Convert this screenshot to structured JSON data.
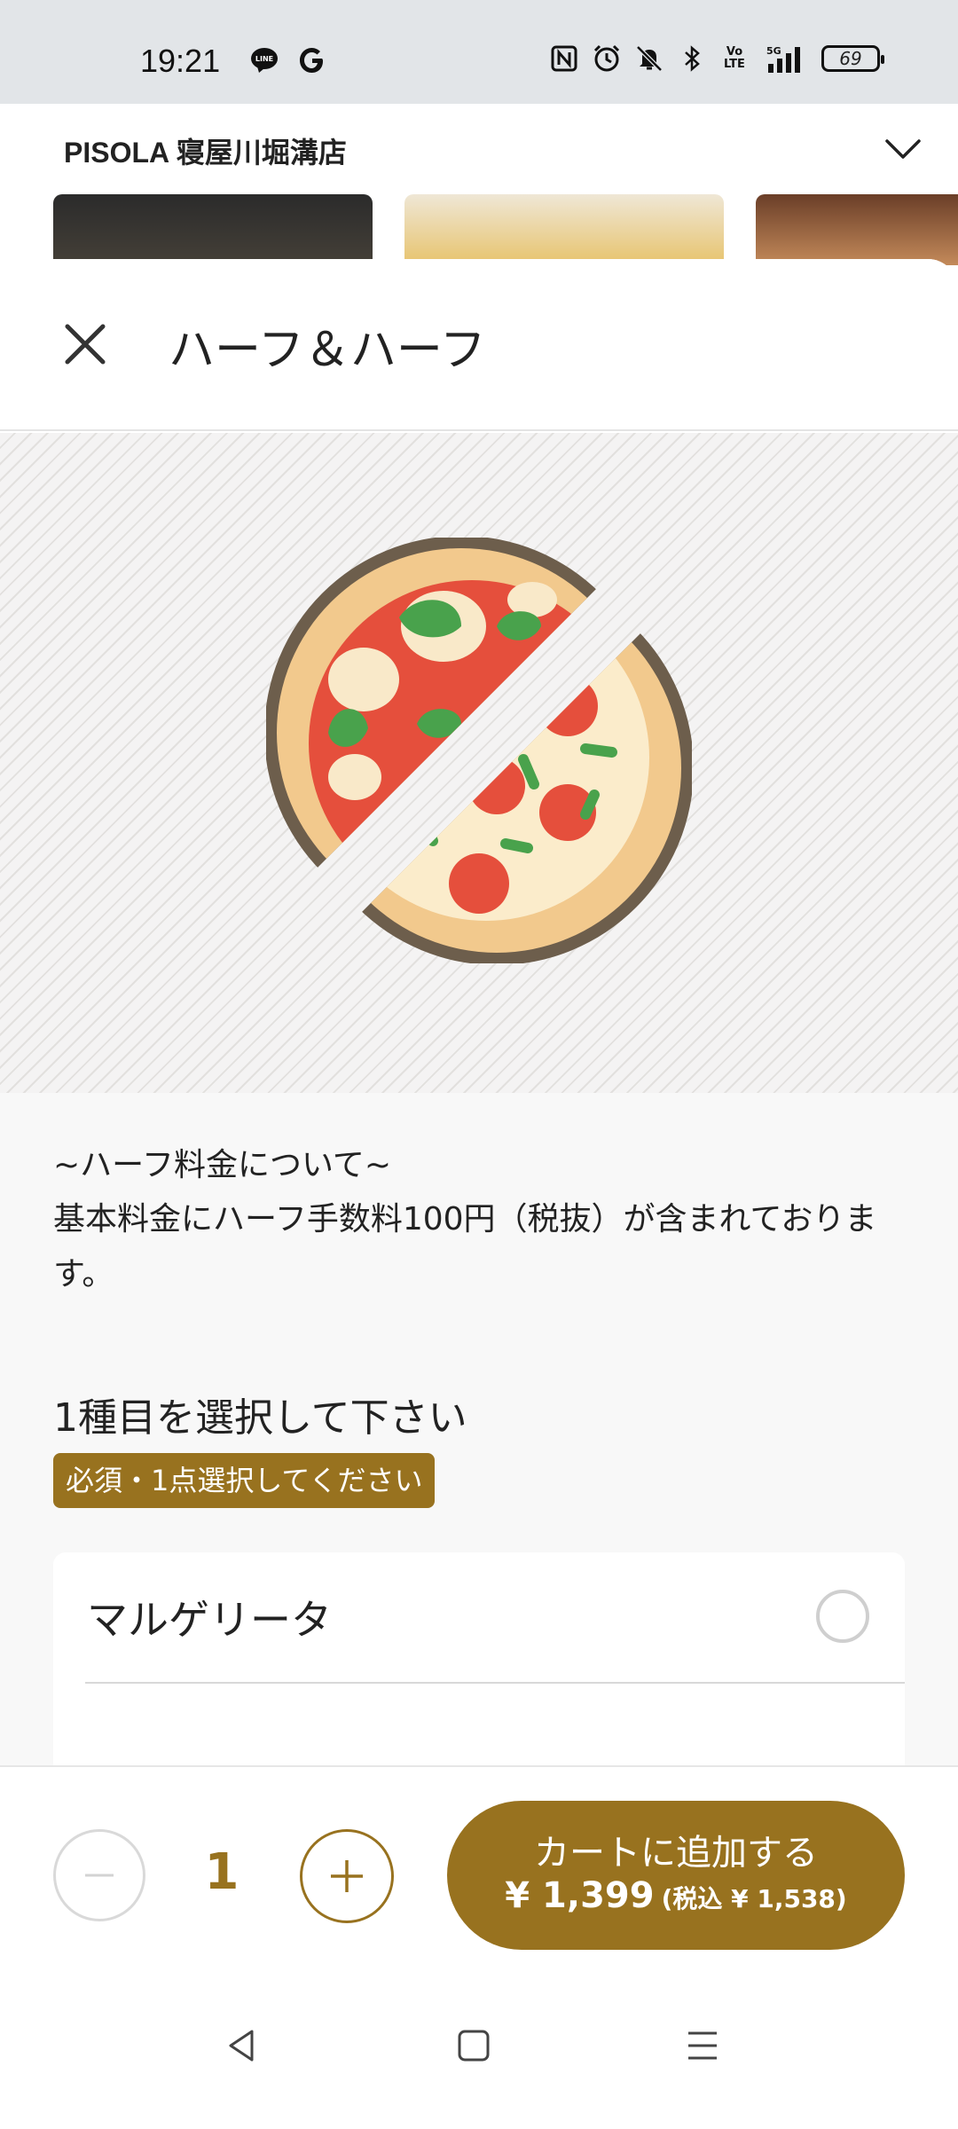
{
  "status_bar": {
    "time": "19:21",
    "left_icons": [
      "line-icon",
      "google-icon"
    ],
    "right_icons": [
      "nfc-icon",
      "alarm-icon",
      "mute-icon",
      "bluetooth-icon",
      "volte-icon",
      "5g-signal-icon"
    ],
    "battery": "69"
  },
  "store": {
    "name": "PISOLA 寝屋川堀溝店"
  },
  "sheet": {
    "title": "ハーフ＆ハーフ",
    "notice_title": "~ハーフ料金について~",
    "notice_body": "基本料金にハーフ手数料100円（税抜）が含まれております。",
    "section_title": "1種目を選択して下さい",
    "required_badge": "必須・1点選択してください",
    "options": [
      {
        "label": "マルゲリータ",
        "selected": false
      }
    ]
  },
  "bottom_bar": {
    "quantity": "1",
    "cart_label": "カートに追加する",
    "price": "¥ 1,399",
    "price_tax": "(税込 ¥ 1,538)"
  },
  "colors": {
    "accent": "#98721f",
    "status_bar_bg": "#e2e5e8",
    "content_bg": "#f8f8f8"
  }
}
